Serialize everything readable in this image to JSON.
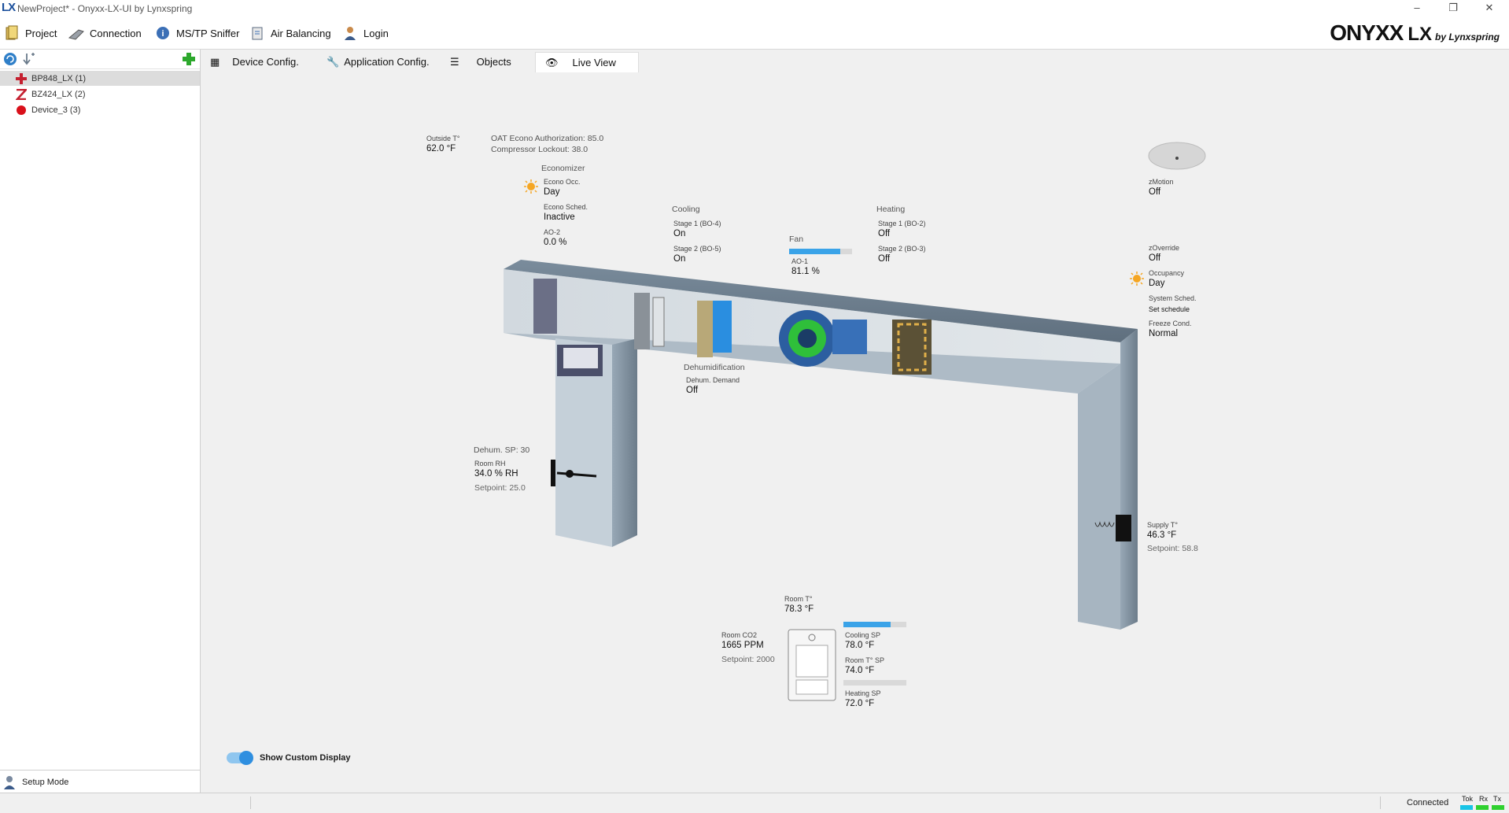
{
  "window": {
    "logo": "LX",
    "title": "NewProject* - Onyxx-LX-UI by Lynxspring",
    "minimize": "–",
    "restore": "❐",
    "close": "✕"
  },
  "menu": {
    "project": "Project",
    "connection": "Connection",
    "sniffer": "MS/TP Sniffer",
    "air_balancing": "Air Balancing",
    "login": "Login"
  },
  "brand": {
    "name": "ONYXX",
    "lx": "LX",
    "by": "by Lynxspring"
  },
  "tree": {
    "items": [
      {
        "label": "BP848_LX (1)",
        "icon": "red-cross-icon"
      },
      {
        "label": "BZ424_LX (2)",
        "icon": "red-z-icon"
      },
      {
        "label": "Device_3 (3)",
        "icon": "red-dot-icon"
      }
    ]
  },
  "setup_mode": "Setup Mode",
  "tabs": {
    "device_config": "Device Config.",
    "application_config": "Application Config.",
    "objects": "Objects",
    "live_view": "Live View"
  },
  "live": {
    "outside_label": "Outside T°",
    "outside_value": "62.0 °F",
    "oat_econo": "OAT Econo Authorization: 85.0",
    "comp_lockout": "Compressor Lockout: 38.0",
    "economizer": {
      "title": "Economizer",
      "occ_label": "Econo Occ.",
      "occ_value": "Day",
      "sched_label": "Econo Sched.",
      "sched_value": "Inactive",
      "ao_label": "AO-2",
      "ao_value": "0.0 %"
    },
    "cooling": {
      "title": "Cooling",
      "s1_label": "Stage 1 (BO-4)",
      "s1_value": "On",
      "s2_label": "Stage 2 (BO-5)",
      "s2_value": "On"
    },
    "fan": {
      "title": "Fan",
      "ao_label": "AO-1",
      "ao_value": "81.1 %",
      "level": 0.811
    },
    "heating": {
      "title": "Heating",
      "s1_label": "Stage 1 (BO-2)",
      "s1_value": "Off",
      "s2_label": "Stage 2 (BO-3)",
      "s2_value": "Off"
    },
    "dehum": {
      "title": "Dehumidification",
      "demand_label": "Dehum. Demand",
      "demand_value": "Off"
    },
    "rh": {
      "sp_top": "Dehum. SP: 30",
      "label": "Room RH",
      "value": "34.0 % RH",
      "setpoint": "Setpoint: 25.0"
    },
    "zmotion": {
      "label": "zMotion",
      "value": "Off"
    },
    "right": {
      "override_label": "zOverride",
      "override_value": "Off",
      "occ_label": "Occupancy",
      "occ_value": "Day",
      "sched_label": "System Sched.",
      "sched_value": "Set schedule",
      "freeze_label": "Freeze Cond.",
      "freeze_value": "Normal"
    },
    "supply": {
      "label": "Supply T°",
      "value": "46.3 °F",
      "setpoint": "Setpoint: 58.8"
    },
    "room": {
      "label": "Room T°",
      "value": "78.3 °F"
    },
    "co2": {
      "label": "Room CO2",
      "value": "1665 PPM",
      "setpoint": "Setpoint: 2000"
    },
    "tstat": {
      "cool_label": "Cooling SP",
      "cool_value": "78.0 °F",
      "cool_level": 0.75,
      "room_sp_label": "Room T° SP",
      "room_sp_value": "74.0 °F",
      "heat_label": "Heating SP",
      "heat_value": "72.0 °F",
      "heat_level": 0.0
    }
  },
  "custom_display": "Show Custom Display",
  "status": {
    "connected": "Connected",
    "tok": "Tok",
    "rx": "Rx",
    "tx": "Tx"
  },
  "colors": {
    "accent": "#3aa3e8",
    "duct": "#8fa3b4",
    "sun": "#f5a623",
    "red": "#d9262c",
    "fan_green": "#2fbf3a"
  }
}
